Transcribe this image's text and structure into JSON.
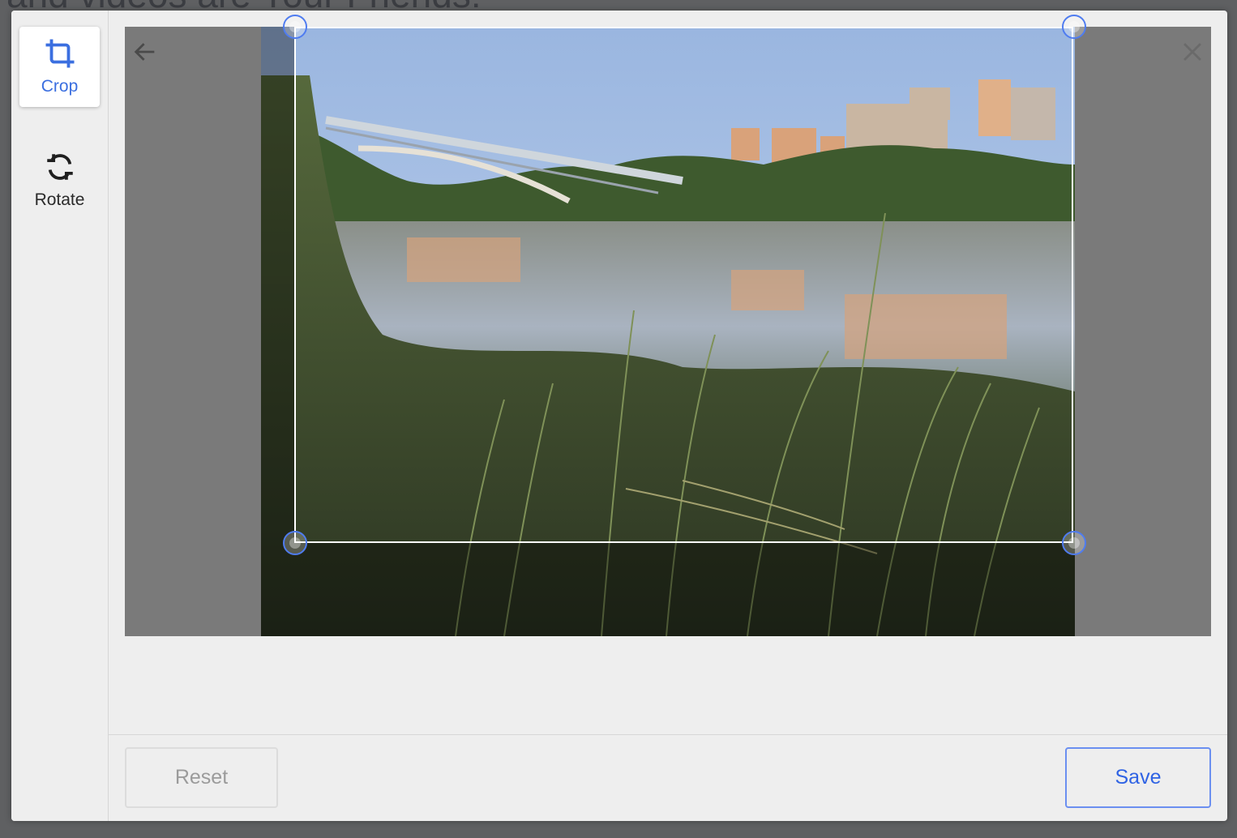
{
  "background_page": {
    "heading_fragment": "and videos are Your Friends!"
  },
  "sidebar": {
    "tools": [
      {
        "label": "Crop",
        "icon": "crop-icon",
        "active": true
      },
      {
        "label": "Rotate",
        "icon": "rotate-icon",
        "active": false
      }
    ]
  },
  "editor": {
    "back_icon": "arrow-left-icon",
    "close_icon": "close-icon",
    "image_description_alt": "River with bridge and buildings at sunset, tall grass in foreground"
  },
  "footer": {
    "reset_label": "Reset",
    "save_label": "Save"
  },
  "colors": {
    "accent": "#3b6fe0",
    "save_border": "#6b8ff0",
    "reset_text": "#9b9b9b"
  }
}
